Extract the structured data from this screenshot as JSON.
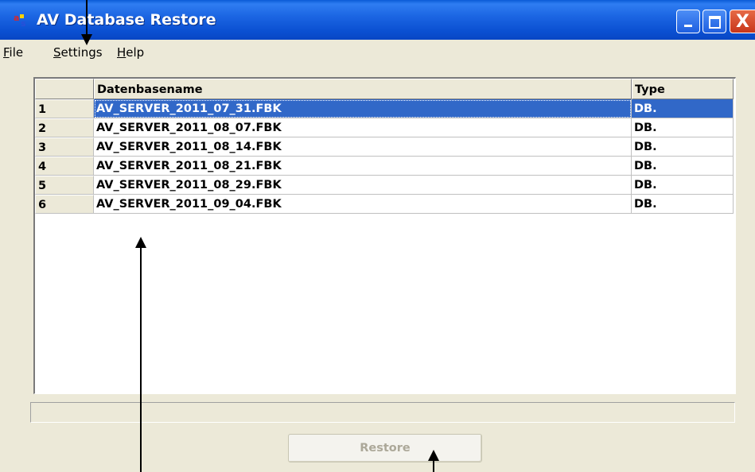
{
  "window": {
    "title": "AV Database Restore",
    "app_icon": "app-icon",
    "caption_buttons": [
      "minimize-icon",
      "maximize-icon",
      "close-icon"
    ],
    "close_glyph": "X"
  },
  "menu": {
    "file": "File",
    "settings": "Settings",
    "help": "Help"
  },
  "grid": {
    "columns": [
      "",
      "Datenbasename",
      "Type"
    ],
    "rows": [
      {
        "num": "1",
        "name": "AV_SERVER_2011_07_31.FBK",
        "type": "DB.",
        "selected": true
      },
      {
        "num": "2",
        "name": "AV_SERVER_2011_08_07.FBK",
        "type": "DB."
      },
      {
        "num": "3",
        "name": "AV_SERVER_2011_08_14.FBK",
        "type": "DB."
      },
      {
        "num": "4",
        "name": "AV_SERVER_2011_08_21.FBK",
        "type": "DB."
      },
      {
        "num": "5",
        "name": "AV_SERVER_2011_08_29.FBK",
        "type": "DB."
      },
      {
        "num": "6",
        "name": "AV_SERVER_2011_09_04.FBK",
        "type": "DB."
      }
    ]
  },
  "restore": {
    "label": "Restore",
    "enabled": false
  },
  "colors": {
    "titlebar": "#0a4fd1",
    "selection": "#3168c8",
    "face": "#ece9d8"
  }
}
